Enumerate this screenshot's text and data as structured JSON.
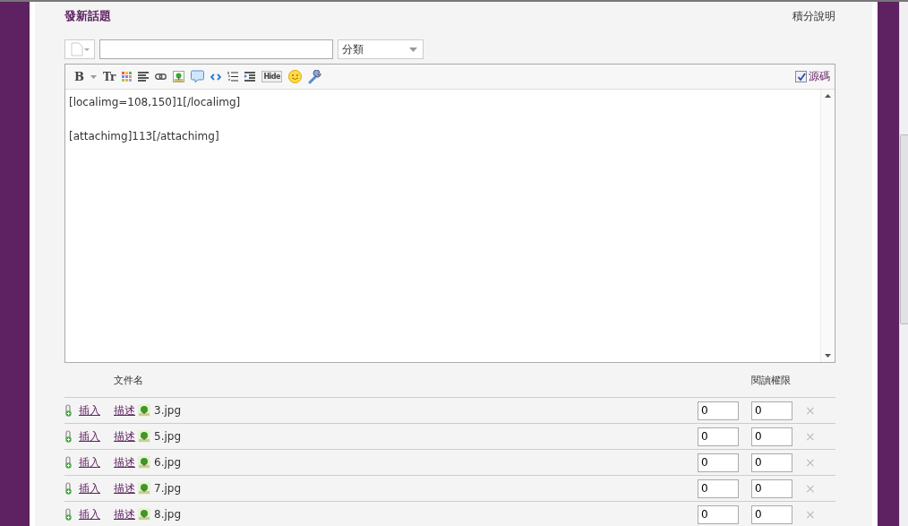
{
  "header": {
    "title": "發新話題",
    "help_link": "積分說明"
  },
  "subject": {
    "category": "分類"
  },
  "toolbar": {
    "buttons": [
      {
        "kind": "bold",
        "label": "B"
      },
      {
        "kind": "caret"
      },
      {
        "kind": "font",
        "label": "Tr"
      },
      {
        "kind": "palette"
      },
      {
        "kind": "align"
      },
      {
        "kind": "link"
      },
      {
        "kind": "image"
      },
      {
        "kind": "quote"
      },
      {
        "kind": "code"
      },
      {
        "kind": "list"
      },
      {
        "kind": "indent"
      },
      {
        "kind": "hide",
        "label": "Hide"
      },
      {
        "kind": "smiley"
      },
      {
        "kind": "wrench"
      }
    ],
    "source_mode": {
      "label": "源碼",
      "checked": true
    }
  },
  "editor": {
    "paragraphs": [
      "[localimg=108,150]1[/localimg]",
      "[attachimg]113[/attachimg]"
    ]
  },
  "attachments": {
    "columns": [
      "文件名",
      "閱讀權限"
    ],
    "rows": [
      {
        "insert": "插入",
        "describe": "描述",
        "filename": "3.jpg",
        "price": "0",
        "permission": "0",
        "delete": "×"
      },
      {
        "insert": "插入",
        "describe": "描述",
        "filename": "5.jpg",
        "price": "0",
        "permission": "0",
        "delete": "×"
      },
      {
        "insert": "插入",
        "describe": "描述",
        "filename": "6.jpg",
        "price": "0",
        "permission": "0",
        "delete": "×"
      },
      {
        "insert": "插入",
        "describe": "描述",
        "filename": "7.jpg",
        "price": "0",
        "permission": "0",
        "delete": "×"
      },
      {
        "insert": "插入",
        "describe": "描述",
        "filename": "8.jpg",
        "price": "0",
        "permission": "0",
        "delete": "×"
      }
    ]
  }
}
